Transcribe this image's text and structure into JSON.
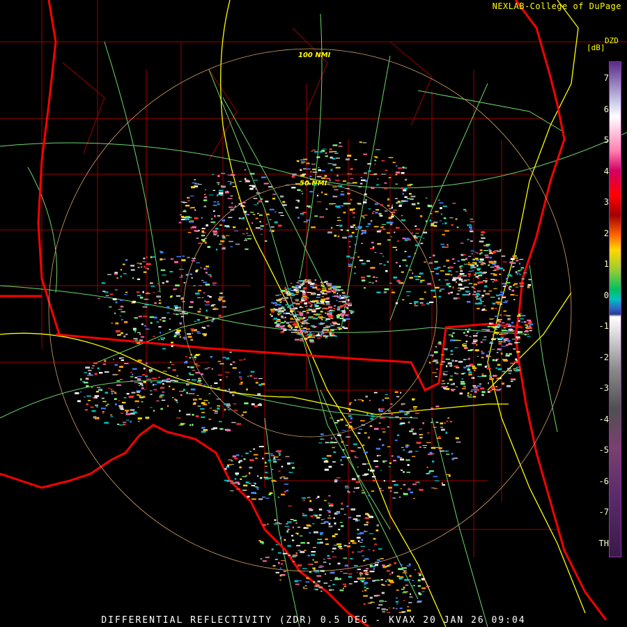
{
  "credit": "NEXLAB-College of DuPage",
  "footer": "DIFFERENTIAL REFLECTIVITY (ZDR) 0.5 DEG - KVAX 20 JAN 26 09:04",
  "legend": {
    "product": "DZD",
    "unit": "[dB]",
    "ticks": [
      "7",
      "6",
      "5",
      "4",
      "3",
      "2",
      "1",
      "0",
      "-1",
      "-2",
      "-3",
      "-4",
      "-5",
      "-6",
      "-7",
      "TH"
    ]
  },
  "range_rings": [
    "100 NMI",
    "50 NMI"
  ],
  "colors": {
    "state_borders": "#ff0000",
    "county_lines": "#b00000",
    "highways": "#7fff7f",
    "interstates": "#ffff00",
    "range_ring": "#d9a36b",
    "text": "#ffff00"
  }
}
